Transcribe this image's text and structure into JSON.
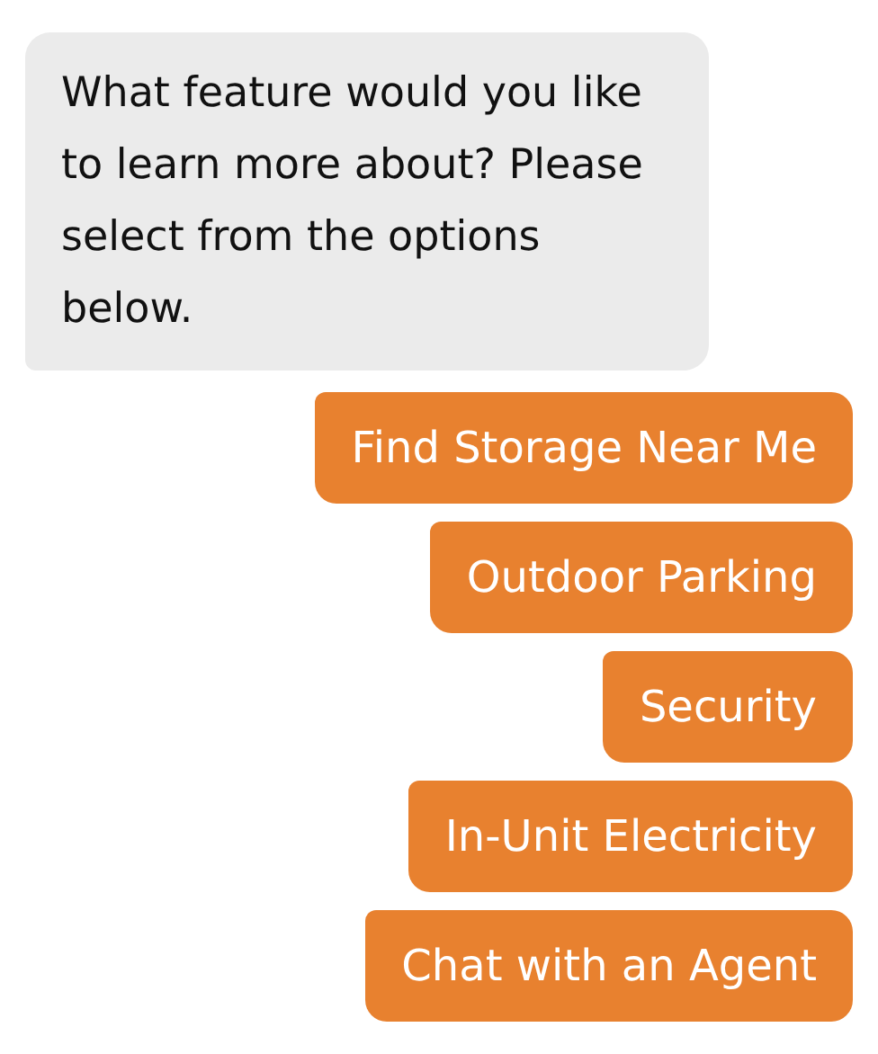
{
  "message": {
    "text": "What feature would you like to learn more about? Please select from the options below."
  },
  "options": [
    {
      "label": "Find Storage Near Me"
    },
    {
      "label": "Outdoor Parking"
    },
    {
      "label": "Security"
    },
    {
      "label": "In-Unit Electricity"
    },
    {
      "label": "Chat with an Agent"
    }
  ]
}
